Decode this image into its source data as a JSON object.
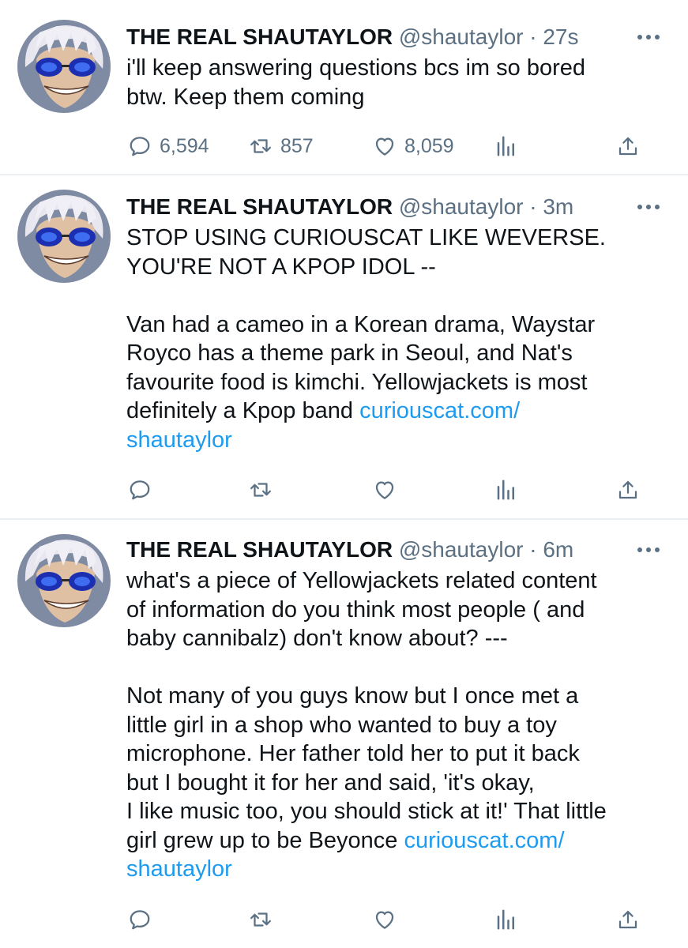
{
  "tweets": [
    {
      "name": "THE REAL SHAUTAYLOR",
      "handle": "@shautaylor",
      "dot": "·",
      "time": "27s",
      "lines": [
        "i'll keep answering questions bcs im so bored",
        "btw. Keep them coming"
      ],
      "replies": "6,594",
      "retweets": "857",
      "likes": "8,059"
    },
    {
      "name": "THE REAL SHAUTAYLOR",
      "handle": "@shautaylor",
      "dot": "·",
      "time": "3m",
      "lines": [
        "STOP USING CURIOUSCAT LIKE WEVERSE.",
        "YOU'RE NOT A KPOP IDOL --",
        "",
        "Van had a cameo in a Korean drama, Waystar",
        "Royco has a theme park in Seoul, and Nat's",
        "favourite food is kimchi. Yellowjackets is most",
        "definitely a Kpop band"
      ],
      "link": [
        "curiouscat.com/",
        "shautaylor"
      ]
    },
    {
      "name": "THE REAL SHAUTAYLOR",
      "handle": "@shautaylor",
      "dot": "·",
      "time": "6m",
      "lines": [
        "what's a piece of Yellowjackets related content",
        "of information do you think most people ( and",
        "baby cannibalz) don't know about? ---",
        "",
        "Not many of you guys know but I once met a",
        "little girl in a shop who wanted to buy a toy",
        "microphone. Her father told her to put it back",
        "but I bought it for her and said, 'it's okay,",
        "I like music too, you should stick at it!' That little",
        "girl grew up to be Beyonce"
      ],
      "link": [
        "curiouscat.com/",
        "shautaylor"
      ]
    }
  ],
  "colors": {
    "text": "#0f1419",
    "secondary": "#5b7083",
    "link": "#1d9bf0",
    "divider": "#eceff1"
  },
  "icons": [
    "reply-icon",
    "retweet-icon",
    "like-icon",
    "analytics-icon",
    "share-icon",
    "more-icon"
  ]
}
